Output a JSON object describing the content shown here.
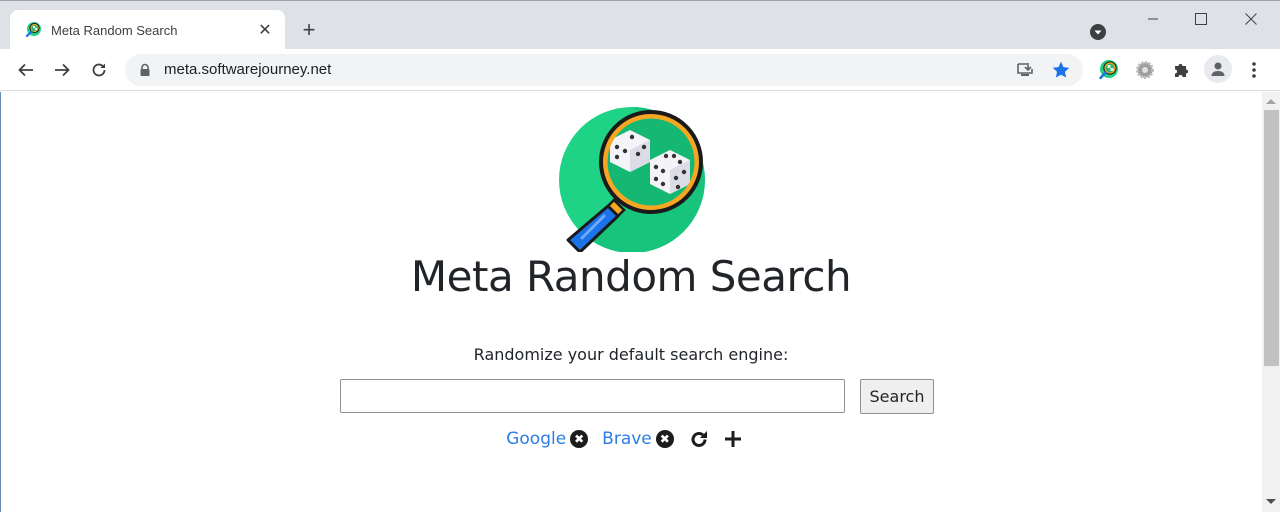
{
  "browser": {
    "tab": {
      "title": "Meta Random Search",
      "close_glyph": "✕"
    },
    "new_tab_glyph": "+",
    "window_controls": [
      "minimize",
      "maximize",
      "close"
    ],
    "omnibox": {
      "url": "meta.softwarejourney.net",
      "secure": true
    },
    "nav_buttons": [
      "back",
      "forward",
      "reload"
    ],
    "omnibox_icons": [
      "install-app-icon",
      "bookmark-star-icon"
    ],
    "extensions": [
      "meta-random-search-extension-icon",
      "gear-extension-icon",
      "extensions-puzzle-icon",
      "profile-avatar-icon",
      "menu-kebab-icon"
    ],
    "colors": {
      "accent_blue": "#1a73e8",
      "titlebar": "#dee1e6"
    }
  },
  "page": {
    "logo_alt": "magnifying glass over dice",
    "heading": "Meta Random Search",
    "subtitle": "Randomize your default search engine:",
    "search_input": {
      "value": "",
      "placeholder": ""
    },
    "search_button": "Search",
    "engines": [
      {
        "name": "Google",
        "remove_glyph": "✖"
      },
      {
        "name": "Brave",
        "remove_glyph": "✖"
      }
    ],
    "actions": [
      "refresh-icon",
      "add-icon"
    ],
    "colors": {
      "link": "#2b7de9",
      "text": "#212529",
      "logo_green": "#1ed386"
    }
  }
}
